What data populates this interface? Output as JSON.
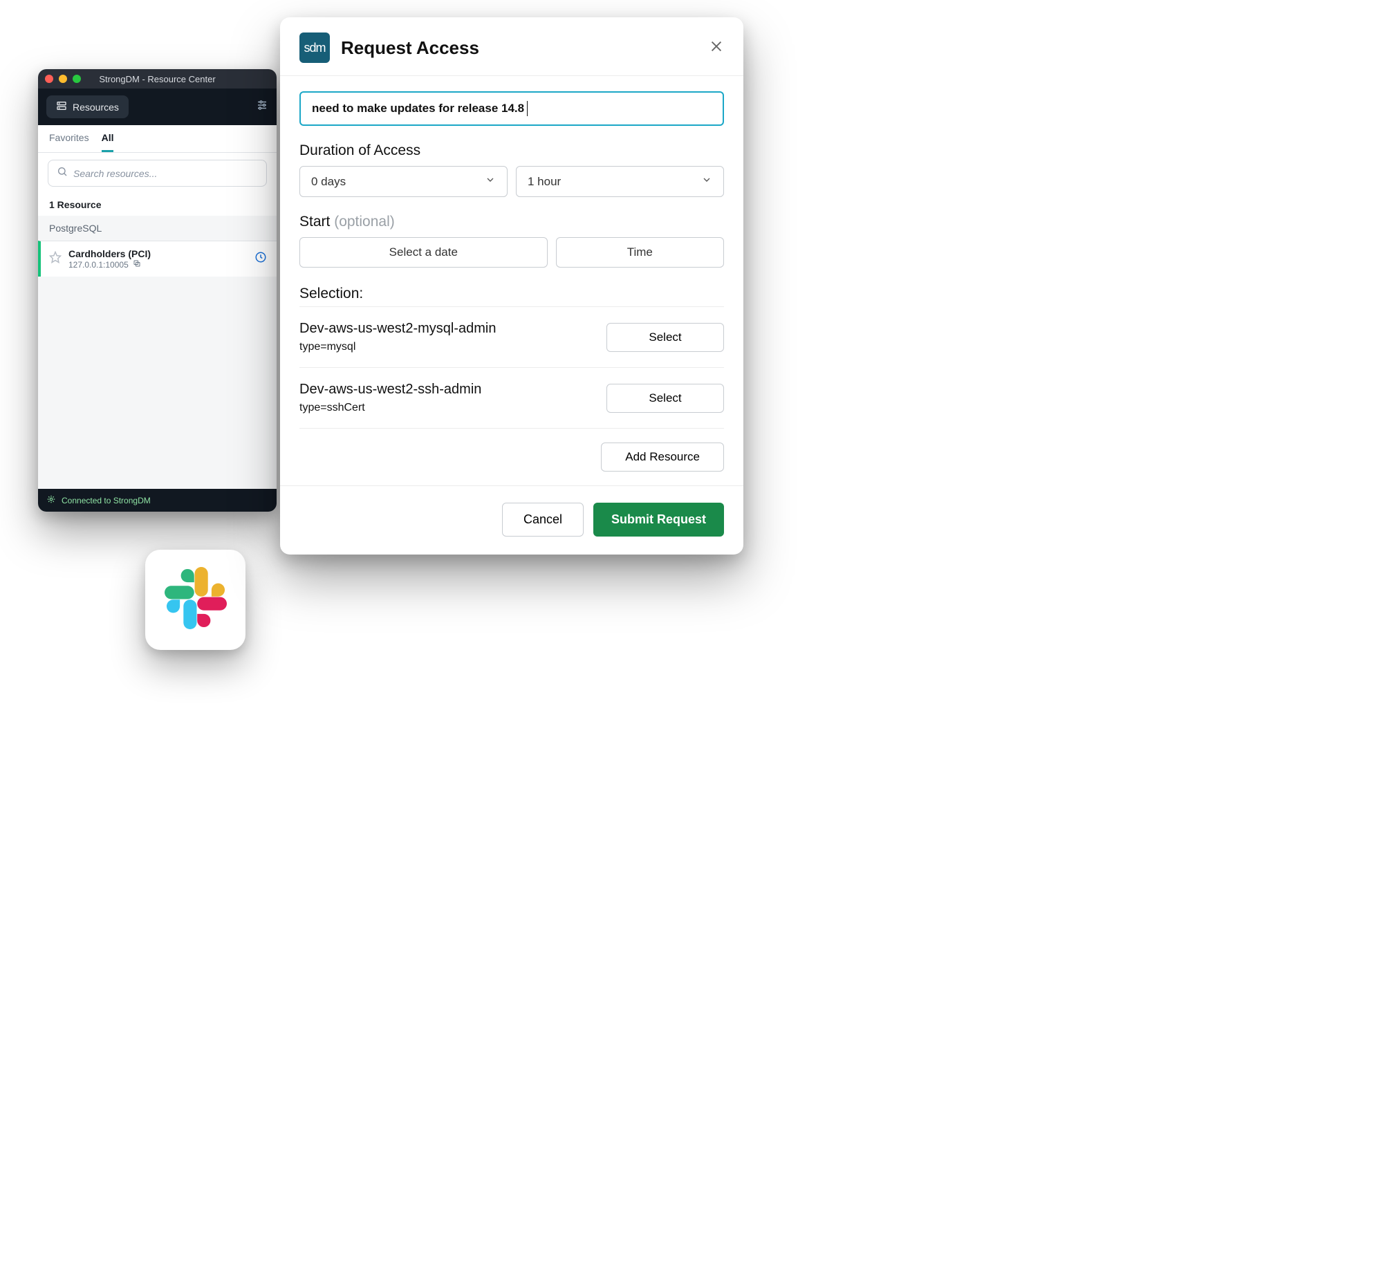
{
  "rc": {
    "title": "StrongDM - Resource Center",
    "tab_label": "Resources",
    "subtabs": {
      "favorites": "Favorites",
      "all": "All"
    },
    "search_placeholder": "Search resources...",
    "count_label": "1 Resource",
    "group_label": "PostgreSQL",
    "item": {
      "name": "Cardholders (PCI)",
      "address": "127.0.0.1:10005"
    },
    "status": "Connected to StrongDM"
  },
  "modal": {
    "title": "Request Access",
    "logo_text": "sdm",
    "reason": "need to make updates for release 14.8",
    "duration_label": "Duration of Access",
    "duration_days": "0 days",
    "duration_time": "1 hour",
    "start_label": "Start",
    "start_optional": "(optional)",
    "start_date_placeholder": "Select a date",
    "start_time_placeholder": "Time",
    "selection_label": "Selection:",
    "items": [
      {
        "name": "Dev-aws-us-west2-mysql-admin",
        "type": "type=mysql",
        "btn": "Select"
      },
      {
        "name": "Dev-aws-us-west2-ssh-admin",
        "type": "type=sshCert",
        "btn": "Select"
      }
    ],
    "add_resource": "Add Resource",
    "cancel": "Cancel",
    "submit": "Submit Request"
  }
}
